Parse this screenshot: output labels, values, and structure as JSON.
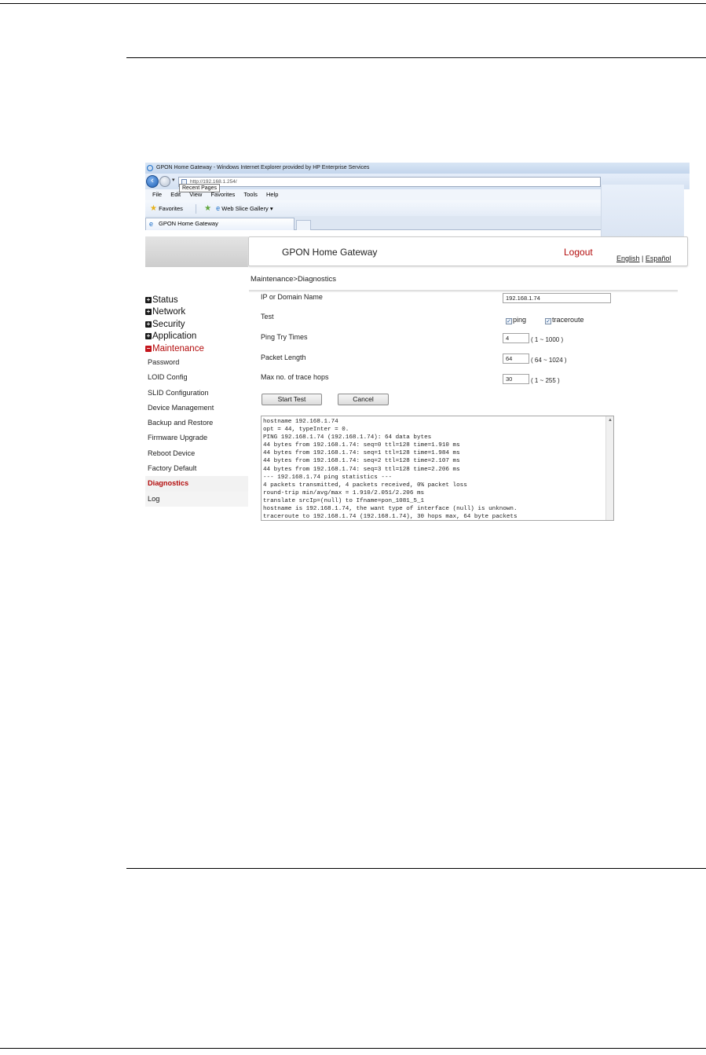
{
  "browser": {
    "title": "GPON Home Gateway - Windows Internet Explorer provided by HP Enterprise Services",
    "address": "http://192.168.1.254/",
    "tooltip": "Recent Pages",
    "menu": [
      "File",
      "Edit",
      "View",
      "Favorites",
      "Tools",
      "Help"
    ],
    "favorites_label": "Favorites",
    "web_slice_label": "Web Slice Gallery ▾",
    "tab_label": "GPON Home Gateway"
  },
  "header": {
    "title": "GPON Home Gateway",
    "logout": "Logout",
    "lang_english": "English",
    "lang_separator": "|",
    "lang_spanish": "Español"
  },
  "breadcrumb": "Maintenance>Diagnostics",
  "nav": {
    "main": [
      "Status",
      "Network",
      "Security",
      "Application"
    ],
    "active_main": "Maintenance",
    "sub": [
      "Password",
      "LOID Config",
      "SLID Configuration",
      "Device Management",
      "Backup and Restore",
      "Firmware Upgrade",
      "Reboot Device",
      "Factory Default"
    ],
    "active_sub": "Diagnostics",
    "last_sub": "Log"
  },
  "form": {
    "ip_label": "IP or Domain Name",
    "ip_value": "192.168.1.74",
    "test_label": "Test",
    "ping_label": "ping",
    "traceroute_label": "traceroute",
    "ping_try_label": "Ping Try Times",
    "ping_try_value": "4",
    "ping_try_range": "( 1 ~ 1000 )",
    "packet_length_label": "Packet Length",
    "packet_length_value": "64",
    "packet_length_range": "( 64 ~ 1024 )",
    "max_hops_label": "Max no. of trace hops",
    "max_hops_value": "30",
    "max_hops_range": "( 1 ~ 255 )",
    "start_button": "Start Test",
    "cancel_button": "Cancel"
  },
  "output_lines": [
    "hostname 192.168.1.74",
    "opt = 44, typeInter = 0.",
    "PING 192.168.1.74 (192.168.1.74): 64 data bytes",
    "44 bytes from 192.168.1.74: seq=0 ttl=128 time=1.910 ms",
    "44 bytes from 192.168.1.74: seq=1 ttl=128 time=1.984 ms",
    "44 bytes from 192.168.1.74: seq=2 ttl=128 time=2.107 ms",
    "44 bytes from 192.168.1.74: seq=3 ttl=128 time=2.206 ms",
    "--- 192.168.1.74 ping statistics ---",
    "4 packets transmitted, 4 packets received, 0% packet loss",
    "round-trip min/avg/max = 1.910/2.051/2.206 ms",
    "translate srcIp=(null) to Ifname=pon_1081_5_1",
    "hostname is 192.168.1.74, the want type of interface (null) is unknown.",
    "traceroute to 192.168.1.74 (192.168.1.74), 30 hops max, 64 byte packets"
  ]
}
